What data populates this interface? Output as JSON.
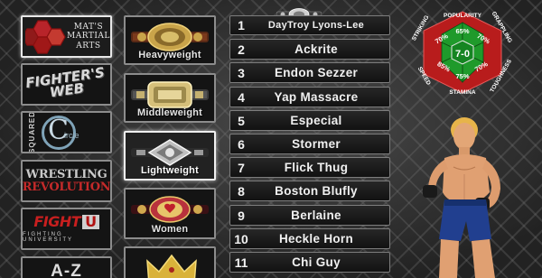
{
  "organizations": {
    "items": [
      {
        "id": "mma",
        "label_lines": [
          "MAT'S",
          "MARTIAL",
          "ARTS"
        ],
        "selected": true
      },
      {
        "id": "web",
        "label_lines": [
          "FIGHTER'S",
          "WEB"
        ]
      },
      {
        "id": "squared",
        "label_word": "SQUARED",
        "label_letter": "C",
        "label_tail": "ircle"
      },
      {
        "id": "wr",
        "label_lines": [
          "WRESTLING",
          "REVOLUTION"
        ]
      },
      {
        "id": "fu",
        "label_main": "FIGHT",
        "label_u": "U",
        "label_sub": "FIGHTING UNIVERSITY"
      },
      {
        "id": "az",
        "label": "A-Z"
      }
    ]
  },
  "divisions": {
    "items": [
      {
        "label": "Heavyweight"
      },
      {
        "label": "Middleweight"
      },
      {
        "label": "Lightweight",
        "selected": true
      },
      {
        "label": "Women"
      }
    ]
  },
  "fighters": {
    "list": [
      {
        "rank": "1",
        "name": "DayTroy Lyons-Lee",
        "champion": true
      },
      {
        "rank": "2",
        "name": "Ackrite"
      },
      {
        "rank": "3",
        "name": "Endon Sezzer"
      },
      {
        "rank": "4",
        "name": "Yap Massacre"
      },
      {
        "rank": "5",
        "name": "Especial"
      },
      {
        "rank": "6",
        "name": "Stormer"
      },
      {
        "rank": "7",
        "name": "Flick Thug"
      },
      {
        "rank": "8",
        "name": "Boston Blufly"
      },
      {
        "rank": "9",
        "name": "Berlaine"
      },
      {
        "rank": "10",
        "name": "Heckle Horn"
      },
      {
        "rank": "11",
        "name": "Chi Guy"
      }
    ]
  },
  "stats": {
    "record": "7-0",
    "labels": {
      "popularity": "POPULARITY",
      "grappling": "GRAPPLING",
      "toughness": "TOUGHNESS",
      "stamina": "STAMINA",
      "speed": "SPEED",
      "striking": "STRIKING"
    },
    "values": {
      "popularity": "65%",
      "grappling": "70%",
      "toughness": "70%",
      "stamina": "75%",
      "speed": "85%",
      "striking": "70%"
    },
    "colors": {
      "frame": "#c42020",
      "fill": "#1e9e2c",
      "text": "#ffffff"
    }
  }
}
